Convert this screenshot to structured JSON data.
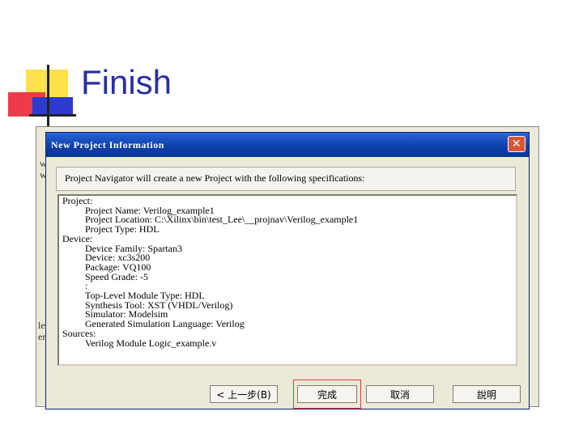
{
  "slide": {
    "title": "Finish"
  },
  "background_fragments": [
    "w",
    "w",
    "le",
    "er"
  ],
  "dialog": {
    "title": "New Project Information",
    "close_symbol": "✕",
    "header": "Project Navigator will create a new Project with the following specifications:",
    "spec": {
      "project_label": "Project:",
      "project_name": "Project Name: Verilog_example1",
      "project_location": "Project Location: C:\\Xilinx\\bin\\test_Lee\\__projnav\\Verilog_example1",
      "project_type": "Project Type: HDL",
      "device_label": "Device:",
      "device_family": "Device Family: Spartan3",
      "device": "Device: xc3s200",
      "package": "Package: VQ100",
      "speed_grade": "Speed Grade: -5",
      "separator": ":",
      "top_level": "Top-Level Module Type: HDL",
      "synthesis_tool": "Synthesis Tool: XST (VHDL/Verilog)",
      "simulator": "Simulator: Modelsim",
      "sim_language": "Generated Simulation Language: Verilog",
      "sources_label": "Sources:",
      "source_1": "Verilog Module Logic_example.v"
    },
    "buttons": {
      "back": "< 上一步(B)",
      "finish": "完成",
      "cancel": "取消",
      "help": "說明"
    }
  },
  "colors": {
    "title_blue": "#2a2fa3",
    "highlight_red": "#e23b3b",
    "titlebar": "#0b3ea8"
  }
}
